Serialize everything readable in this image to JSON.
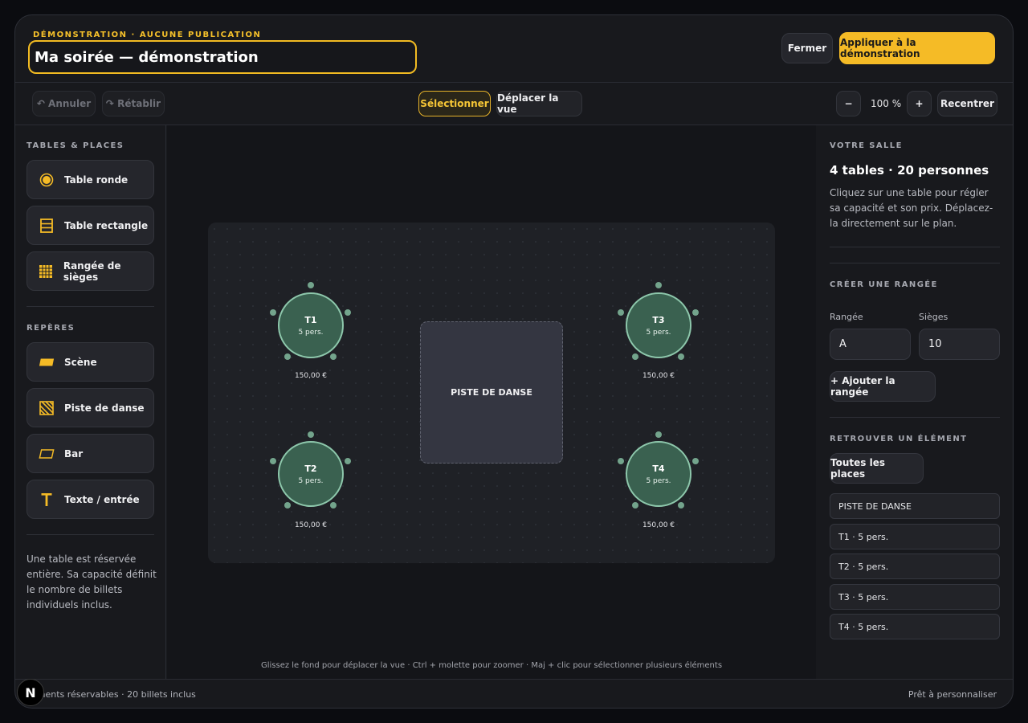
{
  "header": {
    "eyebrow": "DÉMONSTRATION · AUCUNE PUBLICATION",
    "title": "Ma soirée — démonstration",
    "close_label": "Fermer",
    "apply_label": "Appliquer à la démonstration"
  },
  "toolbar": {
    "undo": "↶ Annuler",
    "redo": "↷ Rétablir",
    "select": "Sélectionner",
    "pan": "Déplacer la vue",
    "zoom_out": "−",
    "zoom": "100 %",
    "zoom_in": "+",
    "recenter": "Recentrer"
  },
  "left": {
    "tables_title": "TABLES & PLACES",
    "tables": [
      {
        "label": "Table ronde",
        "icon": "round-table-icon"
      },
      {
        "label": "Table rectangle",
        "icon": "rect-table-icon"
      },
      {
        "label": "Rangée de sièges",
        "icon": "seat-row-icon"
      }
    ],
    "markers_title": "REPÈRES",
    "markers": [
      {
        "label": "Scène",
        "icon": "stage-icon"
      },
      {
        "label": "Piste de danse",
        "icon": "dance-floor-icon"
      },
      {
        "label": "Bar",
        "icon": "bar-icon"
      },
      {
        "label": "Texte / entrée",
        "icon": "text-icon"
      }
    ],
    "note": "Une table est réservée entière. Sa capacité définit le nombre de billets individuels inclus."
  },
  "canvas": {
    "dance_floor": "PISTE DE DANSE",
    "tables": [
      {
        "name": "T1",
        "capacity": "5 pers.",
        "price": "150,00 €"
      },
      {
        "name": "T2",
        "capacity": "5 pers.",
        "price": "150,00 €"
      },
      {
        "name": "T3",
        "capacity": "5 pers.",
        "price": "150,00 €"
      },
      {
        "name": "T4",
        "capacity": "5 pers.",
        "price": "150,00 €"
      }
    ],
    "hint": "Glissez le fond pour déplacer la vue · Ctrl + molette pour zoomer · Maj + clic pour sélectionner plusieurs éléments"
  },
  "right": {
    "room_title": "VOTRE SALLE",
    "summary": "4 tables · 20 personnes",
    "help": "Cliquez sur une table pour régler sa capacité et son prix. Déplacez-la directement sur le plan.",
    "create_row_title": "CRÉER UNE RANGÉE",
    "row_label": "Rangée",
    "seats_label": "Sièges",
    "row_value": "A",
    "seats_value": "10",
    "add_row": "+ Ajouter la rangée",
    "find_title": "RETROUVER UN ÉLÉMENT",
    "all_places": "Toutes les places",
    "items": [
      "PISTE DE DANSE",
      "T1 · 5 pers.",
      "T2 · 5 pers.",
      "T3 · 5 pers.",
      "T4 · 5 pers."
    ]
  },
  "footer": {
    "left": "éments réservables · 20 billets inclus",
    "right": "Prêt à personnaliser",
    "logo": "N"
  },
  "colors": {
    "accent": "#f5bb26",
    "table_fill": "#3a6150",
    "table_border": "#8dc7ab"
  }
}
